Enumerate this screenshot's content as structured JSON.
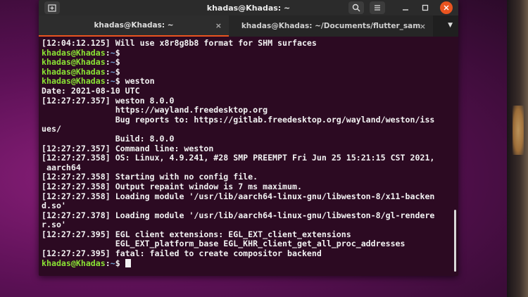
{
  "window": {
    "title": "khadas@Khadas: ~"
  },
  "tabs": [
    {
      "label": "khadas@Khadas: ~",
      "active": true,
      "close": "×"
    },
    {
      "label": "khadas@Khadas: ~/Documents/flutter_sam",
      "active": false,
      "close": "×"
    }
  ],
  "icons": {
    "new_tab": "new-tab-icon",
    "search": "search-icon",
    "menu": "hamburger-menu-icon",
    "minimize": "minimize-icon",
    "maximize": "maximize-icon",
    "close": "close-icon",
    "tabs_dropdown": "chevron-down-icon"
  },
  "colors": {
    "prompt_user": "#8ae234",
    "prompt_path": "#729fcf",
    "close_button": "#e95420",
    "terminal_bg": "#2c0a22"
  },
  "prompt": {
    "user": "khadas@Khadas",
    "sep": ":",
    "path": "~",
    "symbol": "$"
  },
  "terminal_lines": [
    "[12:04:12.125] Will use x8r8g8b8 format for SHM surfaces",
    {
      "prompt": true,
      "cmd": ""
    },
    {
      "prompt": true,
      "cmd": ""
    },
    {
      "prompt": true,
      "cmd": ""
    },
    {
      "prompt": true,
      "cmd": " weston"
    },
    "Date: 2021-08-10 UTC",
    "[12:27:27.357] weston 8.0.0",
    "               https://wayland.freedesktop.org",
    "               Bug reports to: https://gitlab.freedesktop.org/wayland/weston/iss",
    "ues/",
    "               Build: 8.0.0",
    "[12:27:27.357] Command line: weston",
    "[12:27:27.358] OS: Linux, 4.9.241, #28 SMP PREEMPT Fri Jun 25 15:21:15 CST 2021,",
    " aarch64",
    "[12:27:27.358] Starting with no config file.",
    "[12:27:27.358] Output repaint window is 7 ms maximum.",
    "[12:27:27.358] Loading module '/usr/lib/aarch64-linux-gnu/libweston-8/x11-backen",
    "d.so'",
    "[12:27:27.378] Loading module '/usr/lib/aarch64-linux-gnu/libweston-8/gl-rendere",
    "r.so'",
    "[12:27:27.395] EGL client extensions: EGL_EXT_client_extensions",
    "               EGL_EXT_platform_base EGL_KHR_client_get_all_proc_addresses",
    "[12:27:27.395] fatal: failed to create compositor backend",
    {
      "prompt": true,
      "cmd": " ",
      "cursor": true
    }
  ]
}
